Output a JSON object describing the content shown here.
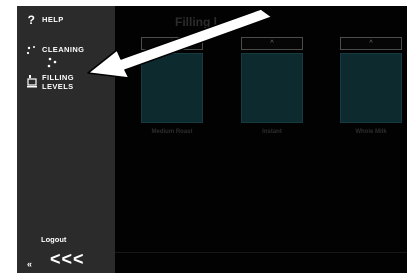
{
  "sidebar": {
    "items": [
      {
        "label": "HELP",
        "icon": "question-mark-icon"
      },
      {
        "label": "CLEANING",
        "icon": "cleaning-icon"
      },
      {
        "label_line1": "FILLING",
        "label_line2": "LEVELS",
        "icon": "cup-icon"
      }
    ],
    "logout": "Logout",
    "back_small": "«",
    "back_big": "<<<"
  },
  "main": {
    "title": "Filling l",
    "hoppers": [
      {
        "name": "Medium Roast",
        "button": "^"
      },
      {
        "name": "Instant",
        "button": "^"
      },
      {
        "name": "Whole Milk",
        "button": "^"
      }
    ]
  },
  "colors": {
    "sidebar_bg": "#2b2b2b",
    "main_bg": "#020202",
    "hopper_fill": "#0d2a2f",
    "annotation_arrow": "#ffffff"
  }
}
